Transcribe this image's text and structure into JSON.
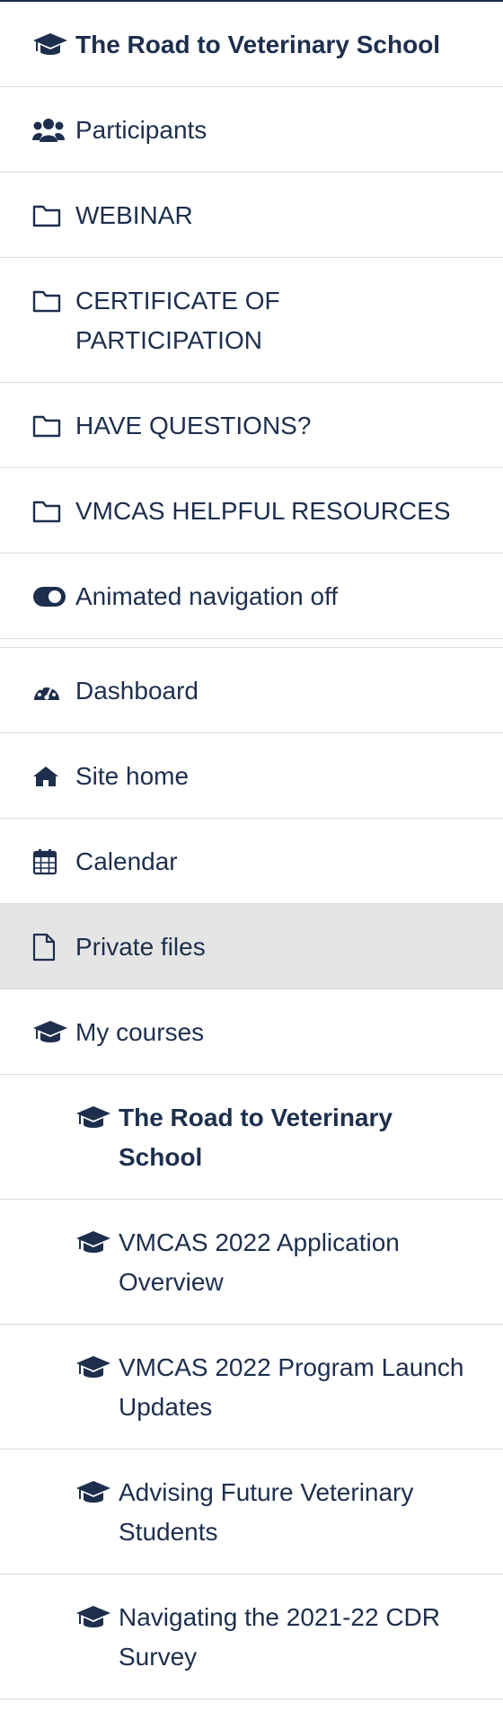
{
  "course_nav": {
    "course_title": "The Road to Veterinary School",
    "participants": "Participants",
    "sections": [
      {
        "label": "WEBINAR"
      },
      {
        "label": "CERTIFICATE OF PARTICIPATION"
      },
      {
        "label": "HAVE QUESTIONS?"
      },
      {
        "label": "VMCAS HELPFUL RESOURCES"
      }
    ],
    "animated_nav": "Animated navigation off"
  },
  "site_nav": {
    "dashboard": "Dashboard",
    "site_home": "Site home",
    "calendar": "Calendar",
    "private_files": "Private files",
    "my_courses": "My courses",
    "courses": [
      {
        "label": "The Road to Veterinary School",
        "current": true
      },
      {
        "label": "VMCAS 2022 Application Overview"
      },
      {
        "label": "VMCAS 2022 Program Launch Updates"
      },
      {
        "label": "Advising Future Veterinary Students"
      },
      {
        "label": "Navigating the 2021-22 CDR Survey"
      }
    ]
  },
  "colors": {
    "text": "#1d2f4d",
    "divider": "#dcdcdc",
    "active_bg": "#e5e5e5"
  }
}
